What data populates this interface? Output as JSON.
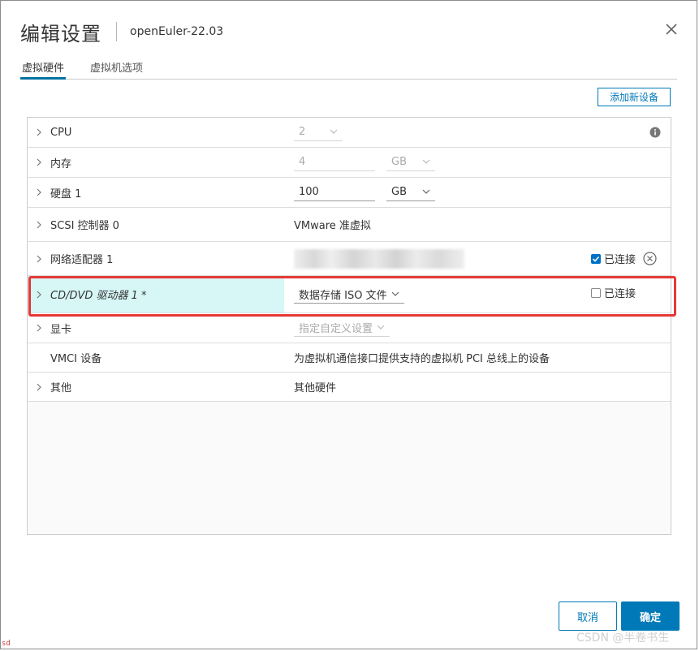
{
  "dialog": {
    "title": "编辑设置",
    "subtitle": "openEuler-22.03",
    "close_icon": "close-icon"
  },
  "tabs": [
    {
      "label": "虚拟硬件",
      "active": true
    },
    {
      "label": "虚拟机选项",
      "active": false
    }
  ],
  "add_device_label": "添加新设备",
  "rows": {
    "cpu": {
      "label": "CPU",
      "value": "2"
    },
    "memory": {
      "label": "内存",
      "value": "4",
      "unit": "GB"
    },
    "disk": {
      "label": "硬盘 1",
      "value": "100",
      "unit": "GB"
    },
    "scsi": {
      "label": "SCSI 控制器 0",
      "value": "VMware 准虚拟"
    },
    "network": {
      "label": "网络适配器 1",
      "connected_label": "已连接",
      "connected": true
    },
    "cddvd": {
      "label": "CD/DVD 驱动器 1 *",
      "value": "数据存储 ISO 文件",
      "connected_label": "已连接",
      "connected": false
    },
    "video": {
      "label": "显卡",
      "value": "指定自定义设置"
    },
    "vmci": {
      "label": "VMCI 设备",
      "value": "为虚拟机通信接口提供支持的虚拟机 PCI 总线上的设备"
    },
    "other": {
      "label": "其他",
      "value": "其他硬件"
    }
  },
  "footer": {
    "cancel_label": "取消",
    "ok_label": "确定"
  },
  "watermark": "CSDN @半卷书生",
  "corner_text": "sd",
  "colors": {
    "accent": "#0079b8",
    "highlight": "#d7f7f7",
    "outline": "#e53935"
  }
}
